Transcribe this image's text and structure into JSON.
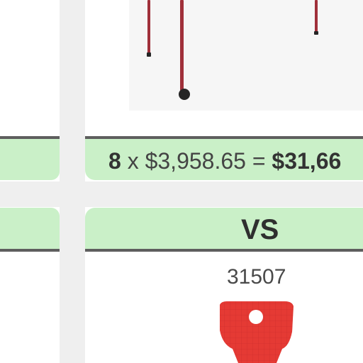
{
  "comparison": {
    "quantity": "8",
    "times_sign": "x",
    "unit_price": "$3,958.65",
    "equals_sign": "=",
    "total": "$31,66",
    "vs_label": "VS",
    "next_product_code": "31507"
  },
  "images": {
    "top_product": "chair-legs-red-frame",
    "bottom_product": "red-plastic-chair-back"
  },
  "colors": {
    "panel_green": "#caf0c8",
    "divider_gray": "#5e5e5e",
    "chair_red": "#e03030",
    "leg_red": "#a0303a"
  }
}
